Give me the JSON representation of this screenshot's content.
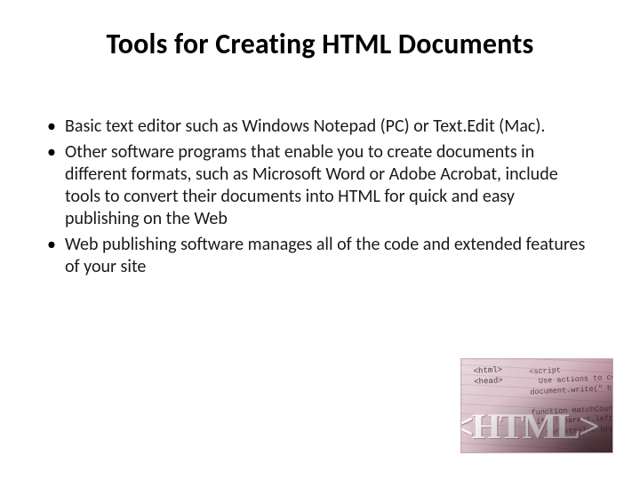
{
  "title": "Tools for Creating HTML Documents",
  "bullets": [
    "Basic text editor such as Windows Notepad (PC) or Text.Edit (Mac).",
    "Other software programs that enable you to create documents in different formats, such as Microsoft Word or Adobe Acrobat, include tools to convert their documents into HTML for quick and easy publishing on the Web",
    "Web publishing software manages all of the code and extended features of your site"
  ],
  "decor": {
    "big": "<HTML>",
    "tags": "<html>\n<head>",
    "code": "<script\n  Use actions to control c\ndocument.write(\" href=\"\n\nfunction matchCount ( ma\n if (!(parent.left.doc\n   var str=loc.href;"
  }
}
